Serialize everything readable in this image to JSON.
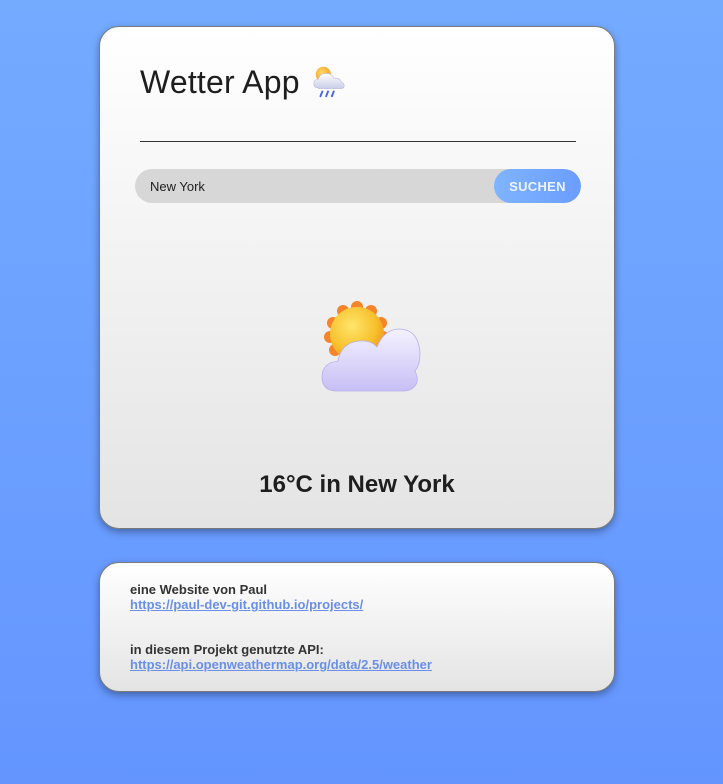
{
  "app": {
    "title": "Wetter App",
    "title_icon": "cloud-rain-icon"
  },
  "search": {
    "value": "New York",
    "button_label": "SUCHEN"
  },
  "weather": {
    "icon": "partly-cloudy-icon",
    "temperature_city": "16°C in New York"
  },
  "footer": {
    "author_label": "eine Website von Paul",
    "author_link": "https://paul-dev-git.github.io/projects/",
    "api_label": "in diesem Projekt genutzte API:",
    "api_link": "https://api.openweathermap.org/data/2.5/weather"
  },
  "colors": {
    "background": "#6a9cff",
    "button": "#74a8ff",
    "link": "#6a8fe8"
  }
}
